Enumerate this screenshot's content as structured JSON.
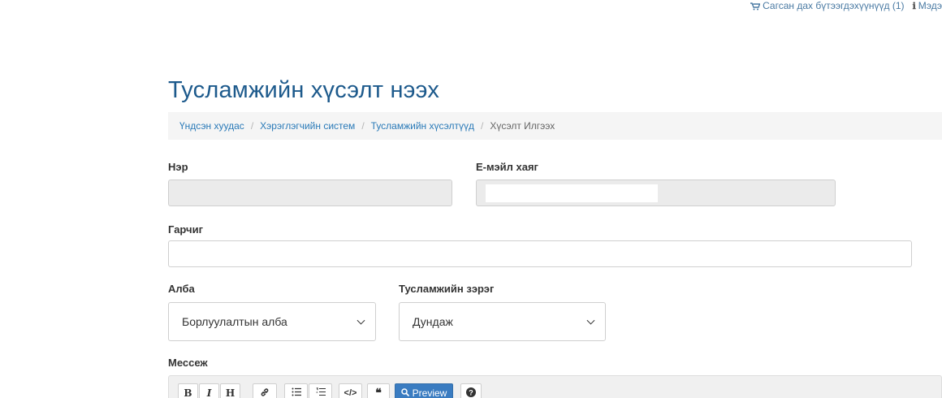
{
  "topbar": {
    "cart_text": "Сагсан дах бүтээгдэхүүнүүд (1)",
    "info_text": "Мэдэ",
    "accent": "#4a7aa3"
  },
  "page": {
    "title": "Тусламжийн хүсэлт нээх",
    "title_color": "#1d5a8c"
  },
  "breadcrumb": {
    "items": [
      "Үндсэн хуудас",
      "Хэрэглэгчийн систем",
      "Тусламжийн хүсэлтүүд"
    ],
    "current": "Хүсэлт Илгээх",
    "separator": "/"
  },
  "form": {
    "name_label": "Нэр",
    "name_value": "",
    "email_label": "Е-мэйл хаяг",
    "email_value": "",
    "subject_label": "Гарчиг",
    "subject_value": "",
    "department_label": "Алба",
    "department_value": "Борлуулалтын алба",
    "priority_label": "Тусламжийн зэрэг",
    "priority_value": "Дундаж",
    "message_label": "Мессеж"
  },
  "editor": {
    "buttons": [
      {
        "icon": "bold-icon",
        "glyph": "B"
      },
      {
        "icon": "italic-icon",
        "glyph": "I"
      },
      {
        "icon": "heading-icon",
        "glyph": "H"
      },
      {
        "icon": "link-icon",
        "glyph": "🔗"
      },
      {
        "icon": "unordered-list-icon",
        "glyph": "☰"
      },
      {
        "icon": "ordered-list-icon",
        "glyph": "☷"
      },
      {
        "icon": "code-icon",
        "glyph": "</>"
      },
      {
        "icon": "quote-icon",
        "glyph": "❝"
      }
    ],
    "preview_label": "Preview",
    "help_glyph": "?",
    "preview_color": "#3a7cc1"
  }
}
